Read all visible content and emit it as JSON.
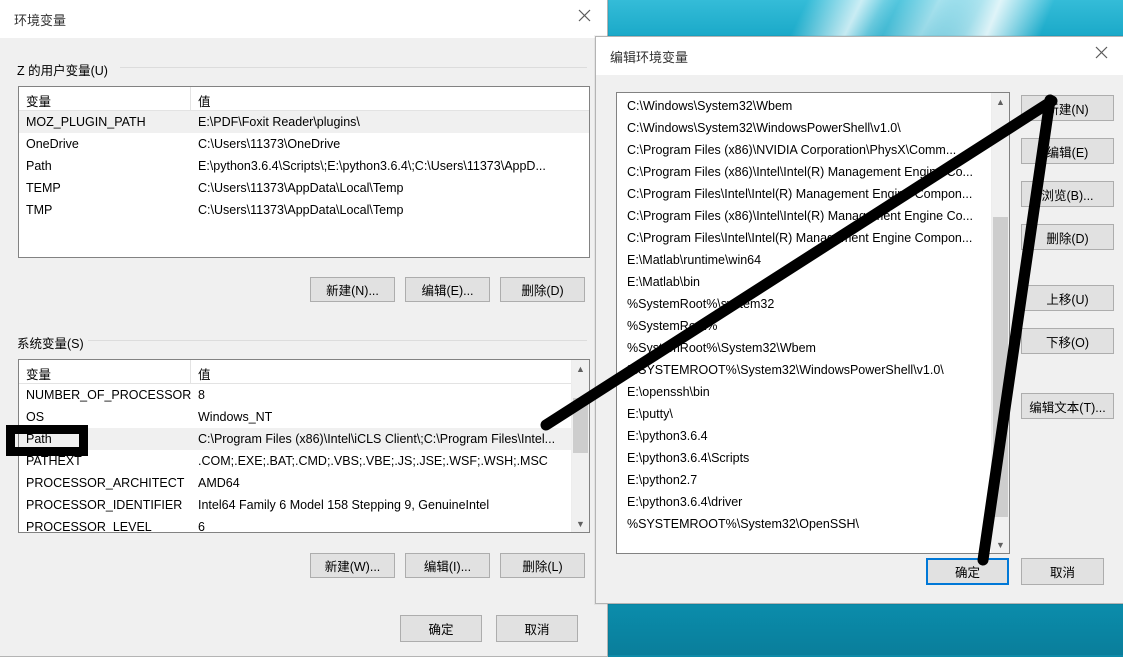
{
  "main_dialog": {
    "title": "环境变量",
    "close_icon": "close-icon",
    "user_group_label": "Z 的用户变量(U)",
    "system_group_label": "系统变量(S)",
    "columns": [
      "变量",
      "值"
    ],
    "user_variables": [
      {
        "name": "MOZ_PLUGIN_PATH",
        "value": "E:\\PDF\\Foxit Reader\\plugins\\",
        "selected": true
      },
      {
        "name": "OneDrive",
        "value": "C:\\Users\\11373\\OneDrive",
        "selected": false
      },
      {
        "name": "Path",
        "value": "E:\\python3.6.4\\Scripts\\;E:\\python3.6.4\\;C:\\Users\\11373\\AppD...",
        "selected": false
      },
      {
        "name": "TEMP",
        "value": "C:\\Users\\11373\\AppData\\Local\\Temp",
        "selected": false
      },
      {
        "name": "TMP",
        "value": "C:\\Users\\11373\\AppData\\Local\\Temp",
        "selected": false
      }
    ],
    "user_buttons": [
      "新建(N)...",
      "编辑(E)...",
      "删除(D)"
    ],
    "system_variables": [
      {
        "name": "NUMBER_OF_PROCESSORS",
        "value": "8",
        "selected": false
      },
      {
        "name": "OS",
        "value": "Windows_NT",
        "selected": false
      },
      {
        "name": "Path",
        "value": "C:\\Program Files (x86)\\Intel\\iCLS Client\\;C:\\Program Files\\Intel...",
        "selected": true
      },
      {
        "name": "PATHEXT",
        "value": ".COM;.EXE;.BAT;.CMD;.VBS;.VBE;.JS;.JSE;.WSF;.WSH;.MSC",
        "selected": false
      },
      {
        "name": "PROCESSOR_ARCHITECT",
        "value": "AMD64",
        "selected": false
      },
      {
        "name": "PROCESSOR_IDENTIFIER",
        "value": "Intel64 Family 6 Model 158 Stepping 9, GenuineIntel",
        "selected": false
      },
      {
        "name": "PROCESSOR_LEVEL",
        "value": "6",
        "selected": false
      }
    ],
    "system_buttons": [
      "新建(W)...",
      "编辑(I)...",
      "删除(L)"
    ],
    "ok_label": "确定",
    "cancel_label": "取消"
  },
  "edit_dialog": {
    "title": "编辑环境变量",
    "close_icon": "close-icon",
    "path_entries": [
      "C:\\Windows\\System32\\Wbem",
      "C:\\Windows\\System32\\WindowsPowerShell\\v1.0\\",
      "C:\\Program Files (x86)\\NVIDIA Corporation\\PhysX\\Comm...",
      "C:\\Program Files (x86)\\Intel\\Intel(R) Management Engine Co...",
      "C:\\Program Files\\Intel\\Intel(R) Management Engine Compon...",
      "C:\\Program Files (x86)\\Intel\\Intel(R) Management Engine Co...",
      "C:\\Program Files\\Intel\\Intel(R) Management Engine Compon...",
      "E:\\Matlab\\runtime\\win64",
      "E:\\Matlab\\bin",
      "%SystemRoot%\\system32",
      "%SystemRoot%",
      "%SystemRoot%\\System32\\Wbem",
      "%SYSTEMROOT%\\System32\\WindowsPowerShell\\v1.0\\",
      "E:\\openssh\\bin",
      "E:\\putty\\",
      "E:\\python3.6.4",
      "E:\\python3.6.4\\Scripts",
      "E:\\python2.7",
      "E:\\python3.6.4\\driver",
      "%SYSTEMROOT%\\System32\\OpenSSH\\"
    ],
    "side_buttons": [
      "新建(N)",
      "编辑(E)",
      "浏览(B)...",
      "删除(D)",
      "上移(U)",
      "下移(O)",
      "编辑文本(T)..."
    ],
    "ok_label": "确定",
    "cancel_label": "取消"
  },
  "annotations": {
    "path_highlight_box": "black-rectangle-around-path",
    "stroke_new_button": "black-diagonal-line-to-new-button",
    "stroke_ok_button": "black-diagonal-line-to-ok-button"
  }
}
